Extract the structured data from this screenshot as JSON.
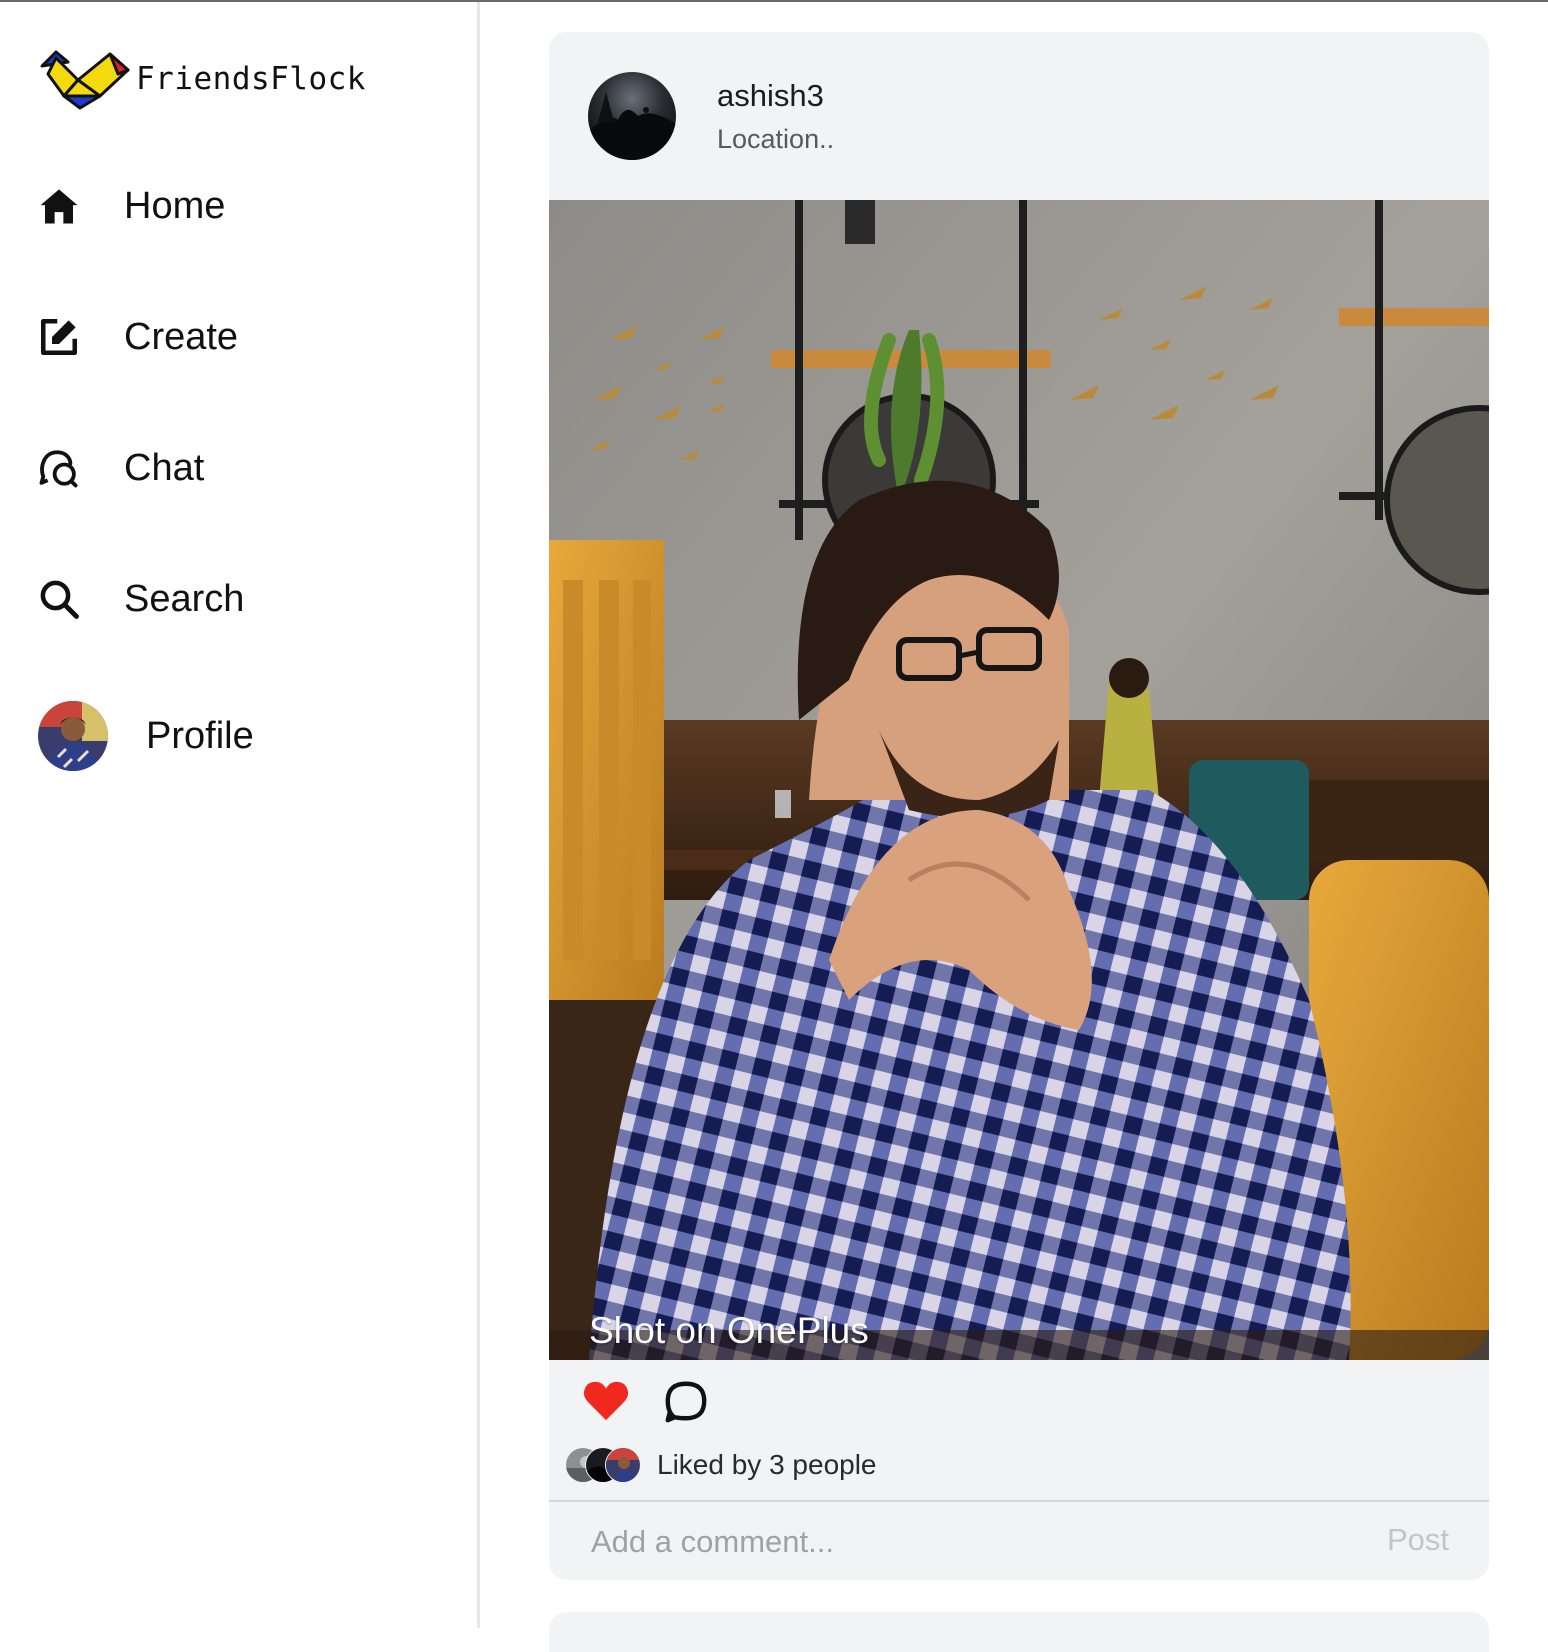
{
  "app": {
    "name": "FriendsFlock"
  },
  "sidebar": {
    "items": [
      {
        "label": "Home",
        "icon": "home-icon"
      },
      {
        "label": "Create",
        "icon": "edit-icon"
      },
      {
        "label": "Chat",
        "icon": "chat-icon"
      },
      {
        "label": "Search",
        "icon": "search-icon"
      },
      {
        "label": "Profile",
        "icon": "avatar"
      }
    ]
  },
  "post": {
    "username": "ashish3",
    "location": "Location..",
    "image_watermark": "Shot on OnePlus",
    "liked": true,
    "likes_text": "Liked by 3 people",
    "comment_placeholder": "Add a comment...",
    "post_label": "Post"
  },
  "colors": {
    "like_red": "#f0281e",
    "card_bg": "#f2f3f5",
    "muted_text": "#9ea2a8"
  }
}
